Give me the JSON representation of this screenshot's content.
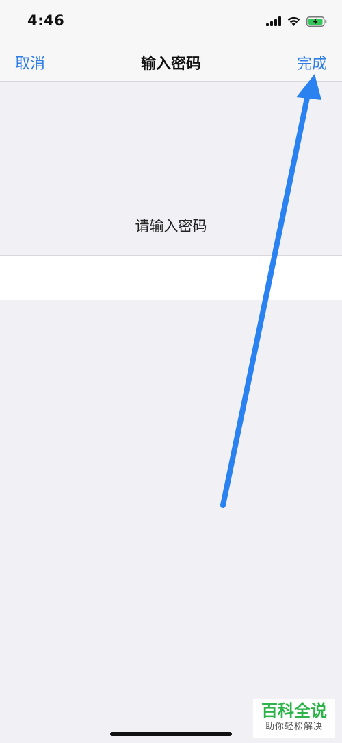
{
  "status_bar": {
    "time": "4:46",
    "icons": [
      "cellular-signal-icon",
      "wifi-icon",
      "battery-charging-icon"
    ]
  },
  "nav": {
    "cancel_label": "取消",
    "title": "输入密码",
    "done_label": "完成"
  },
  "main": {
    "prompt": "请输入密码",
    "password_value": "",
    "placeholder": ""
  },
  "annotation": {
    "arrow_color": "#2a82f0"
  },
  "watermark": {
    "title": "百科全说",
    "subtitle": "助你轻松解决"
  },
  "colors": {
    "accent": "#2f7ee6",
    "background": "#f1f1f5",
    "battery": "#33c759",
    "watermark_green": "#2db34a"
  }
}
